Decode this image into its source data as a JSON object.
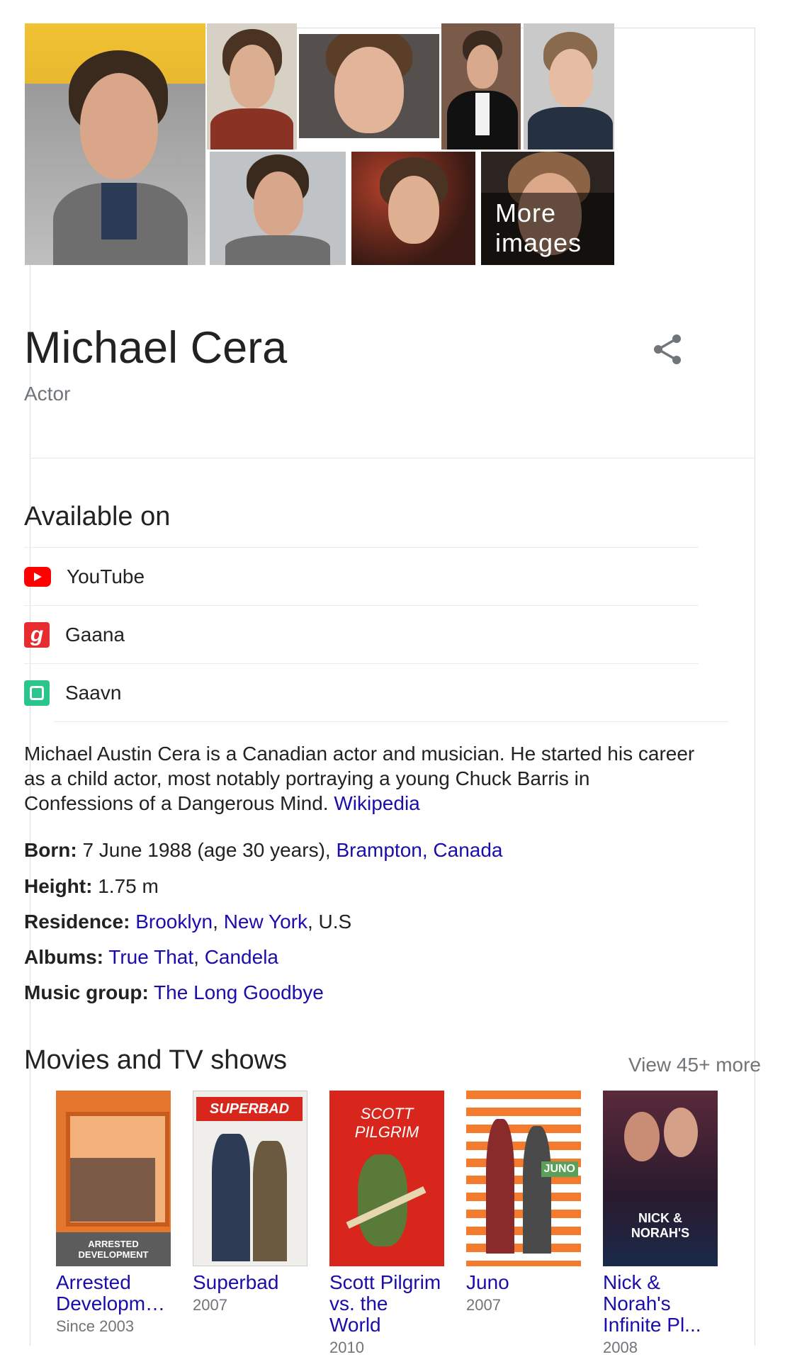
{
  "images": {
    "more_label": "More images"
  },
  "header": {
    "name": "Michael Cera",
    "description": "Actor"
  },
  "available_on": {
    "title": "Available on",
    "items": [
      {
        "label": "YouTube",
        "icon": "youtube-icon",
        "color": "#ff0000"
      },
      {
        "label": "Gaana",
        "icon": "gaana-icon",
        "color": "#e72c30"
      },
      {
        "label": "Saavn",
        "icon": "saavn-icon",
        "color": "#2bc48a"
      }
    ]
  },
  "bio": {
    "text": "Michael Austin Cera is a Canadian actor and musician. He started his career as a child actor, most notably portraying a young Chuck Barris in Confessions of a Dangerous Mind.",
    "source": "Wikipedia"
  },
  "facts": {
    "born": {
      "label": "Born:",
      "text": "7 June 1988 (age 30 years),",
      "link": "Brampton, Canada"
    },
    "height": {
      "label": "Height:",
      "text": "1.75 m"
    },
    "residence": {
      "label": "Residence:",
      "link1": "Brooklyn",
      "sep": ",",
      "link2": "New York",
      "tail": ", U.S"
    },
    "albums": {
      "label": "Albums:",
      "link1": "True That",
      "sep": ",",
      "link2": "Candela"
    },
    "music_group": {
      "label": "Music group:",
      "link": "The Long Goodbye"
    }
  },
  "movies": {
    "title": "Movies and TV shows",
    "view_more": "View 45+ more",
    "items": [
      {
        "title": "Arrested Developm…",
        "year": "Since 2003",
        "poster_text": "ARRESTED DEVELOPMENT"
      },
      {
        "title": "Superbad",
        "year": "2007",
        "poster_text": "SUPERBAD"
      },
      {
        "title": "Scott Pilgrim vs. the World",
        "year": "2010",
        "poster_text": "SCOTT PILGRIM"
      },
      {
        "title": "Juno",
        "year": "2007",
        "poster_text": "JUNO"
      },
      {
        "title": "Nick & Norah's Infinite Pl...",
        "year": "2008",
        "poster_text": "NICK & NORAH'S"
      }
    ]
  },
  "colors": {
    "link": "#1a0dab",
    "muted": "#70757a",
    "divider": "#e4e4e4"
  }
}
